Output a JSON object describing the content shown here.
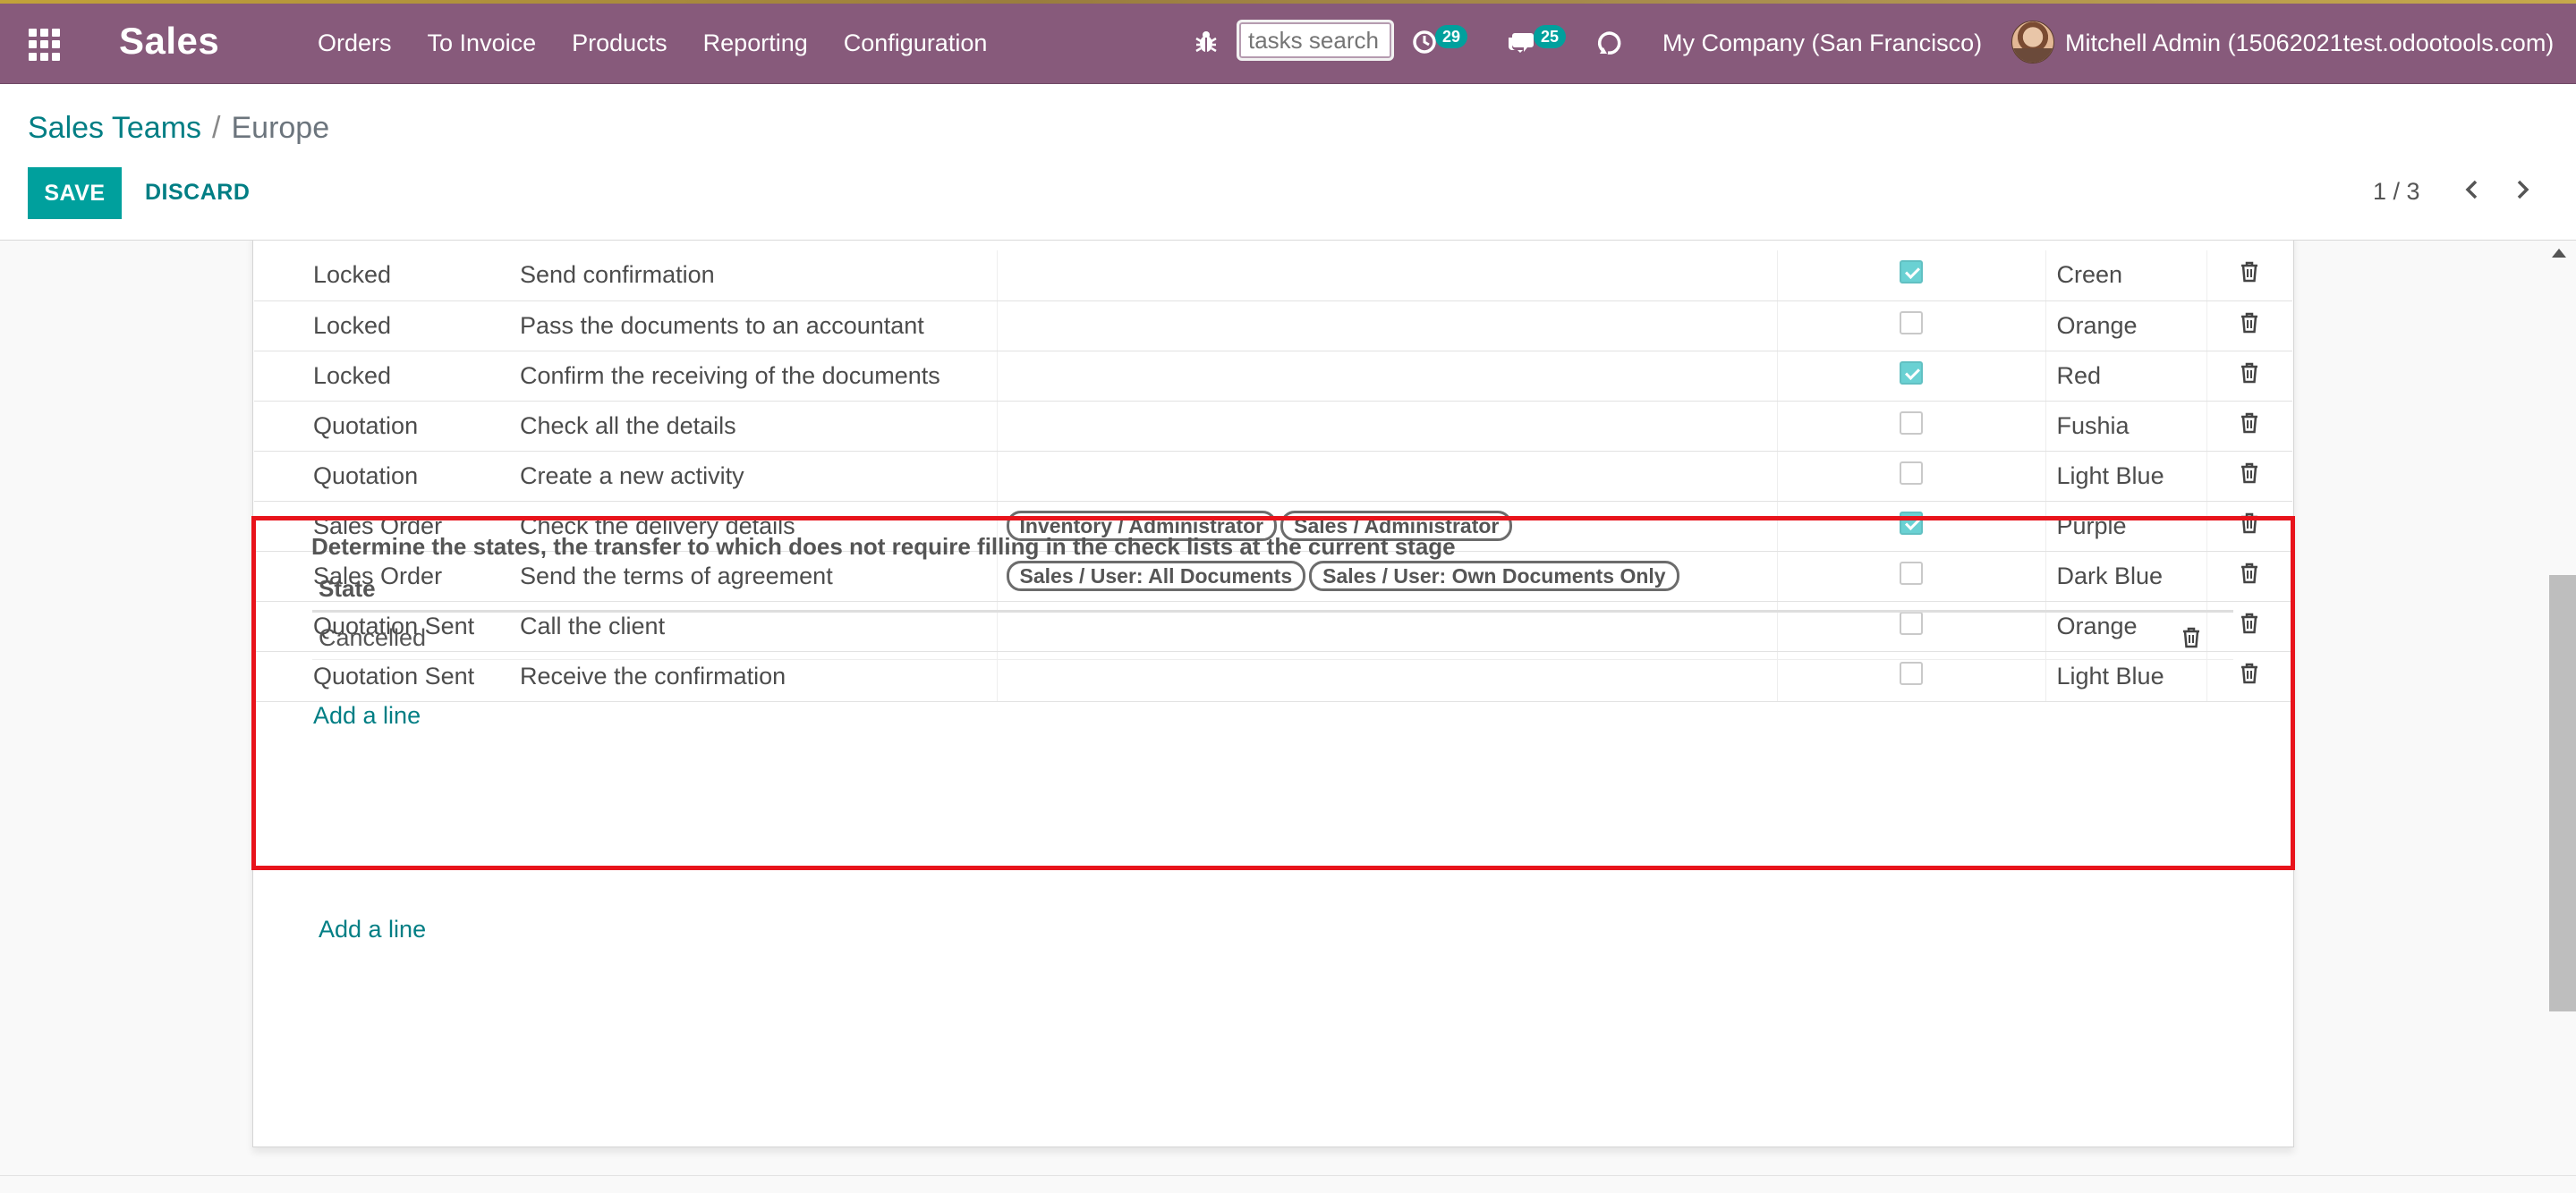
{
  "app": {
    "title": "Sales"
  },
  "nav": {
    "menu": [
      "Orders",
      "To Invoice",
      "Products",
      "Reporting",
      "Configuration"
    ],
    "search_placeholder": "tasks search",
    "activities_count": "29",
    "messages_count": "25",
    "company": "My Company (San Francisco)",
    "user": "Mitchell Admin (15062021test.odootools.com)"
  },
  "breadcrumb": {
    "parent": "Sales Teams",
    "separator": "/",
    "current": "Europe"
  },
  "actions": {
    "save": "SAVE",
    "discard": "DISCARD"
  },
  "pager": {
    "text": "1 / 3"
  },
  "checklist": {
    "rows": [
      {
        "state": "Locked",
        "name": "Send confirmation",
        "groups": [],
        "checked": true,
        "color": "Creen"
      },
      {
        "state": "Locked",
        "name": "Pass the documents to an accountant",
        "groups": [],
        "checked": false,
        "color": "Orange"
      },
      {
        "state": "Locked",
        "name": "Confirm the receiving of the documents",
        "groups": [],
        "checked": true,
        "color": "Red"
      },
      {
        "state": "Quotation",
        "name": "Check all the details",
        "groups": [],
        "checked": false,
        "color": "Fushia"
      },
      {
        "state": "Quotation",
        "name": "Create a new activity",
        "groups": [],
        "checked": false,
        "color": "Light Blue"
      },
      {
        "state": "Sales Order",
        "name": "Check the delivery details",
        "groups": [
          "Inventory / Administrator",
          "Sales / Administrator"
        ],
        "checked": true,
        "color": "Purple"
      },
      {
        "state": "Sales Order",
        "name": "Send the terms of agreement",
        "groups": [
          "Sales / User: All Documents",
          "Sales / User: Own Documents Only"
        ],
        "checked": false,
        "color": "Dark Blue"
      },
      {
        "state": "Quotation Sent",
        "name": "Call the client",
        "groups": [],
        "checked": false,
        "color": "Orange"
      },
      {
        "state": "Quotation Sent",
        "name": "Receive the confirmation",
        "groups": [],
        "checked": false,
        "color": "Light Blue"
      }
    ],
    "add_line": "Add a line"
  },
  "no_check_states": {
    "title": "Determine the states, the transfer to which does not require filling in the check lists at the current stage",
    "column_header": "State",
    "rows": [
      "Cancelled"
    ],
    "add_line": "Add a line"
  },
  "colors": {
    "navbar": "#875a7b",
    "accent": "#00a09d",
    "link": "#017e84",
    "highlight": "#e8131b",
    "checked": "#6ad1d3"
  }
}
